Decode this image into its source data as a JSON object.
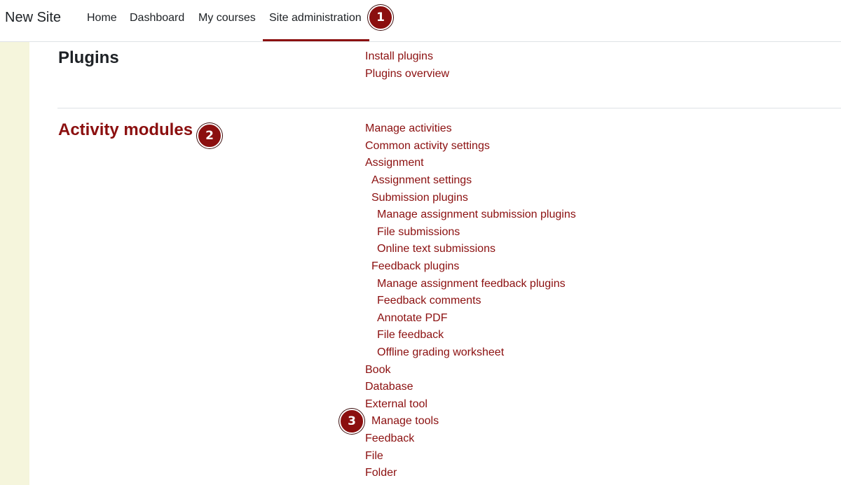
{
  "navbar": {
    "brand": "New Site",
    "items": [
      {
        "label": "Home"
      },
      {
        "label": "Dashboard"
      },
      {
        "label": "My courses"
      },
      {
        "label": "Site administration",
        "active": true
      }
    ]
  },
  "annotations": [
    "1",
    "2",
    "3"
  ],
  "sections": [
    {
      "title": "Plugins",
      "links": [
        "Install plugins",
        "Plugins overview"
      ]
    },
    {
      "title": "Activity modules",
      "links": [
        "Manage activities",
        "Common activity settings",
        "Assignment",
        "Assignment settings",
        "Submission plugins",
        "Manage assignment submission plugins",
        "File submissions",
        "Online text submissions",
        "Feedback plugins",
        "Manage assignment feedback plugins",
        "Feedback comments",
        "Annotate PDF",
        "File feedback",
        "Offline grading worksheet",
        "Book",
        "Database",
        "External tool",
        "Manage tools",
        "Feedback",
        "File",
        "Folder"
      ]
    }
  ],
  "colors": {
    "accent": "#8b0f0f",
    "left_strip": "#f5f5dc"
  }
}
